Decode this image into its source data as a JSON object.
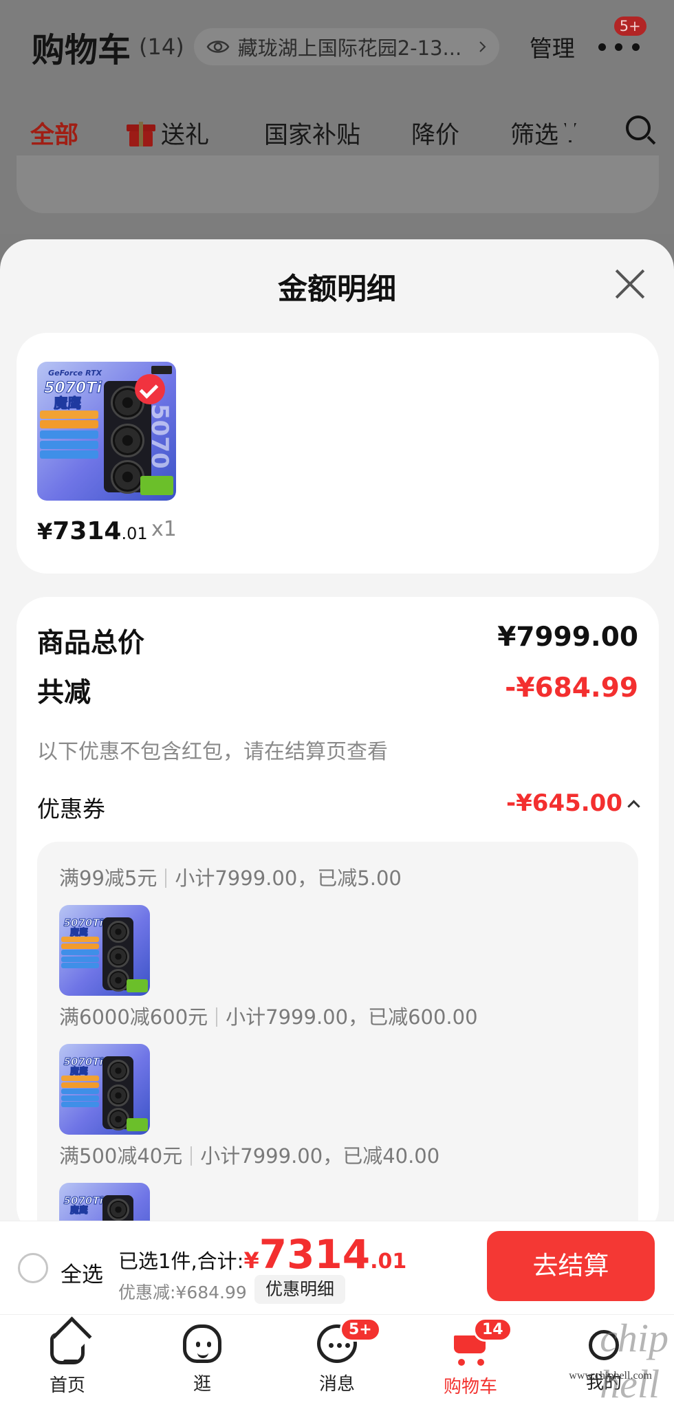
{
  "header": {
    "title": "购物车",
    "count": "(14)",
    "address": "藏珑湖上国际花园2-13...",
    "manage": "管理",
    "more_badge": "5+",
    "tabs": [
      "全部",
      "送礼",
      "国家补贴",
      "降价",
      "筛选"
    ]
  },
  "sheet": {
    "title": "金额明细",
    "item": {
      "price_symbol": "¥",
      "price_int": "7314",
      "price_dec": ".01",
      "qty": "x1",
      "image_text": {
        "brand": "GeForce RTX",
        "model": "5070Ti",
        "cn": "魔鹰",
        "vertical": "5070"
      }
    },
    "summary": {
      "total_label": "商品总价",
      "total_value": "¥7999.00",
      "reduce_label": "共减",
      "reduce_value": "-¥684.99",
      "hint": "以下优惠不包含红包，请在结算页查看",
      "coupon_label": "优惠券",
      "coupon_value": "-¥645.00"
    },
    "coupons": [
      {
        "rule": "满99减5元",
        "detail": "小计7999.00，已减5.00"
      },
      {
        "rule": "满6000减600元",
        "detail": "小计7999.00，已减600.00"
      },
      {
        "rule": "满500减40元",
        "detail": "小计7999.00，已减40.00"
      }
    ]
  },
  "checkout": {
    "select_all": "全选",
    "total_label": "已选1件,合计:",
    "total_symbol": "¥",
    "total_int": "7314",
    "total_dec": ".01",
    "discount": "优惠减:¥684.99",
    "detail_button": "优惠明细",
    "checkout_button": "去结算"
  },
  "nav": {
    "items": [
      {
        "label": "首页",
        "icon": "home-icon"
      },
      {
        "label": "逛",
        "icon": "explore-icon"
      },
      {
        "label": "消息",
        "icon": "message-icon",
        "badge": "5+"
      },
      {
        "label": "购物车",
        "icon": "cart-icon",
        "badge": "14"
      },
      {
        "label": "我的",
        "icon": "profile-icon"
      }
    ]
  },
  "watermark": {
    "text": "www.chiphell.com"
  },
  "colors": {
    "accent": "#f43834",
    "price_red": "#f32f2f",
    "sheet_bg": "#f4f4f4",
    "overlay": "#7c7c7c"
  }
}
